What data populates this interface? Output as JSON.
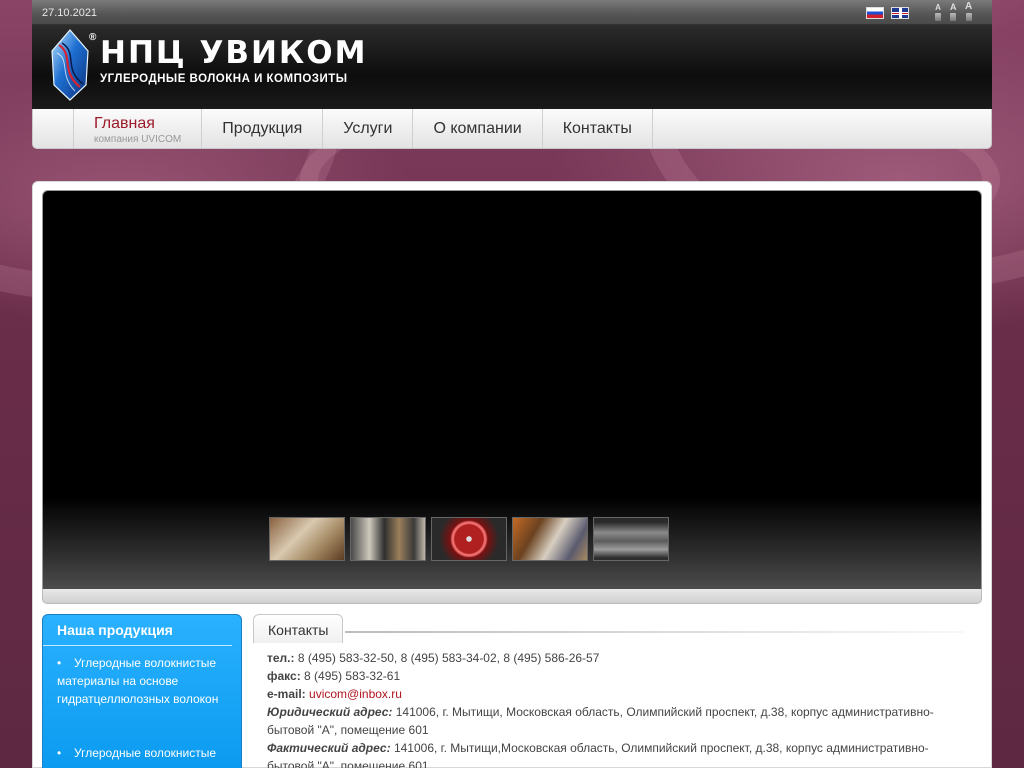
{
  "topbar": {
    "date": "27.10.2021",
    "languages": [
      {
        "code": "ru",
        "icon": "flag-russia-icon"
      },
      {
        "code": "en",
        "icon": "flag-uk-icon"
      }
    ],
    "font_sizes": [
      "A",
      "A",
      "A"
    ]
  },
  "header": {
    "brand": "НПЦ УВИКОМ",
    "reg_mark": "®",
    "tagline": "УГЛЕРОДНЫЕ ВОЛОКНА И КОМПОЗИТЫ",
    "logo_icon": "crystal-logo-icon"
  },
  "nav": {
    "items": [
      {
        "label": "Главная",
        "sub": "компания UVICOM",
        "active": true
      },
      {
        "label": "Продукция"
      },
      {
        "label": "Услуги"
      },
      {
        "label": "О компании"
      },
      {
        "label": "Контакты"
      }
    ]
  },
  "slider": {
    "thumbnails": [
      "certificate-photo",
      "equipment-photo",
      "red-rotor-photo",
      "award-photo",
      "carbon-tube-photo"
    ]
  },
  "sidebar": {
    "title": "Наша продукция",
    "items": [
      "Углеродные волокнистые материалы на основе гидратцеллюлозных волокон",
      "Углеродные волокнистые материалы на основе"
    ]
  },
  "contacts": {
    "tab": "Контакты",
    "tel_label": "тел.:",
    "tel": "8 (495) 583-32-50, 8 (495) 583-34-02, 8 (495) 586-26-57",
    "fax_label": "факс:",
    "fax": "8 (495) 583-32-61",
    "email_label": "e-mail:",
    "email": "uvicom@inbox.ru",
    "legal_label": "Юридический адрес:",
    "legal": "141006, г. Мытищи, Московская область, Олимпийский проспект, д.38, корпус административно-бытовой \"А\", помещение 601",
    "actual_label": "Фактический адрес:",
    "actual": "141006, г. Мытищи,Московская область, Олимпийский проспект, д.38, корпус административно-бытовой \"А\", помещение 601"
  },
  "colors": {
    "background": "#6e2f4c",
    "accent": "#9c1a2a",
    "sidebar": "#1aa6fa",
    "link": "#b3141f"
  }
}
